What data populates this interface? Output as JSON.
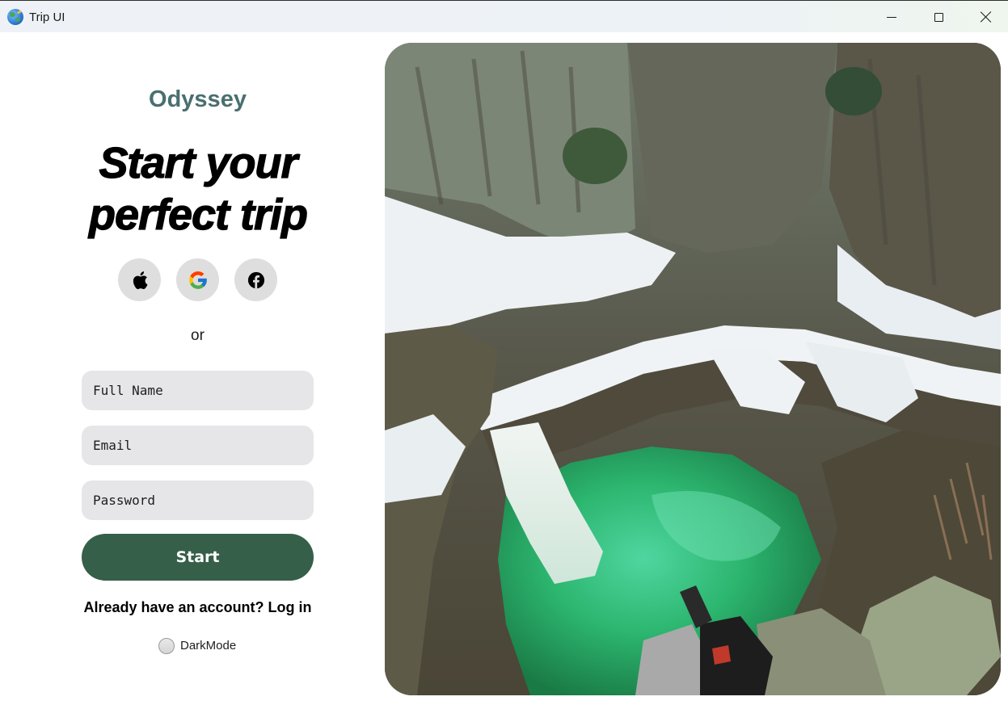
{
  "window": {
    "title": "Trip UI",
    "icon": "globe-icon",
    "controls": [
      "minimize-icon",
      "maximize-icon",
      "close-icon"
    ]
  },
  "brand": "Odyssey",
  "headline": {
    "line1": "Start your",
    "line2": "perfect trip"
  },
  "social": [
    {
      "name": "Apple",
      "icon": "apple-icon"
    },
    {
      "name": "Google",
      "icon": "google-icon"
    },
    {
      "name": "Facebook",
      "icon": "facebook-icon"
    }
  ],
  "separator": "or",
  "form": {
    "full_name_placeholder": "Full Name",
    "email_placeholder": "Email",
    "password_placeholder": "Password",
    "submit_label": "Start"
  },
  "login_prompt": "Already have an account? Log in",
  "dark_mode": {
    "label": "DarkMode",
    "checked": false
  },
  "colors": {
    "brand": "#4a6f70",
    "primary_button": "#355f49",
    "field_bg": "#e6e6e8",
    "social_bg": "#dedede"
  },
  "hero_image": {
    "subject": "canyon-waterfall-photo",
    "icon": "photo"
  }
}
